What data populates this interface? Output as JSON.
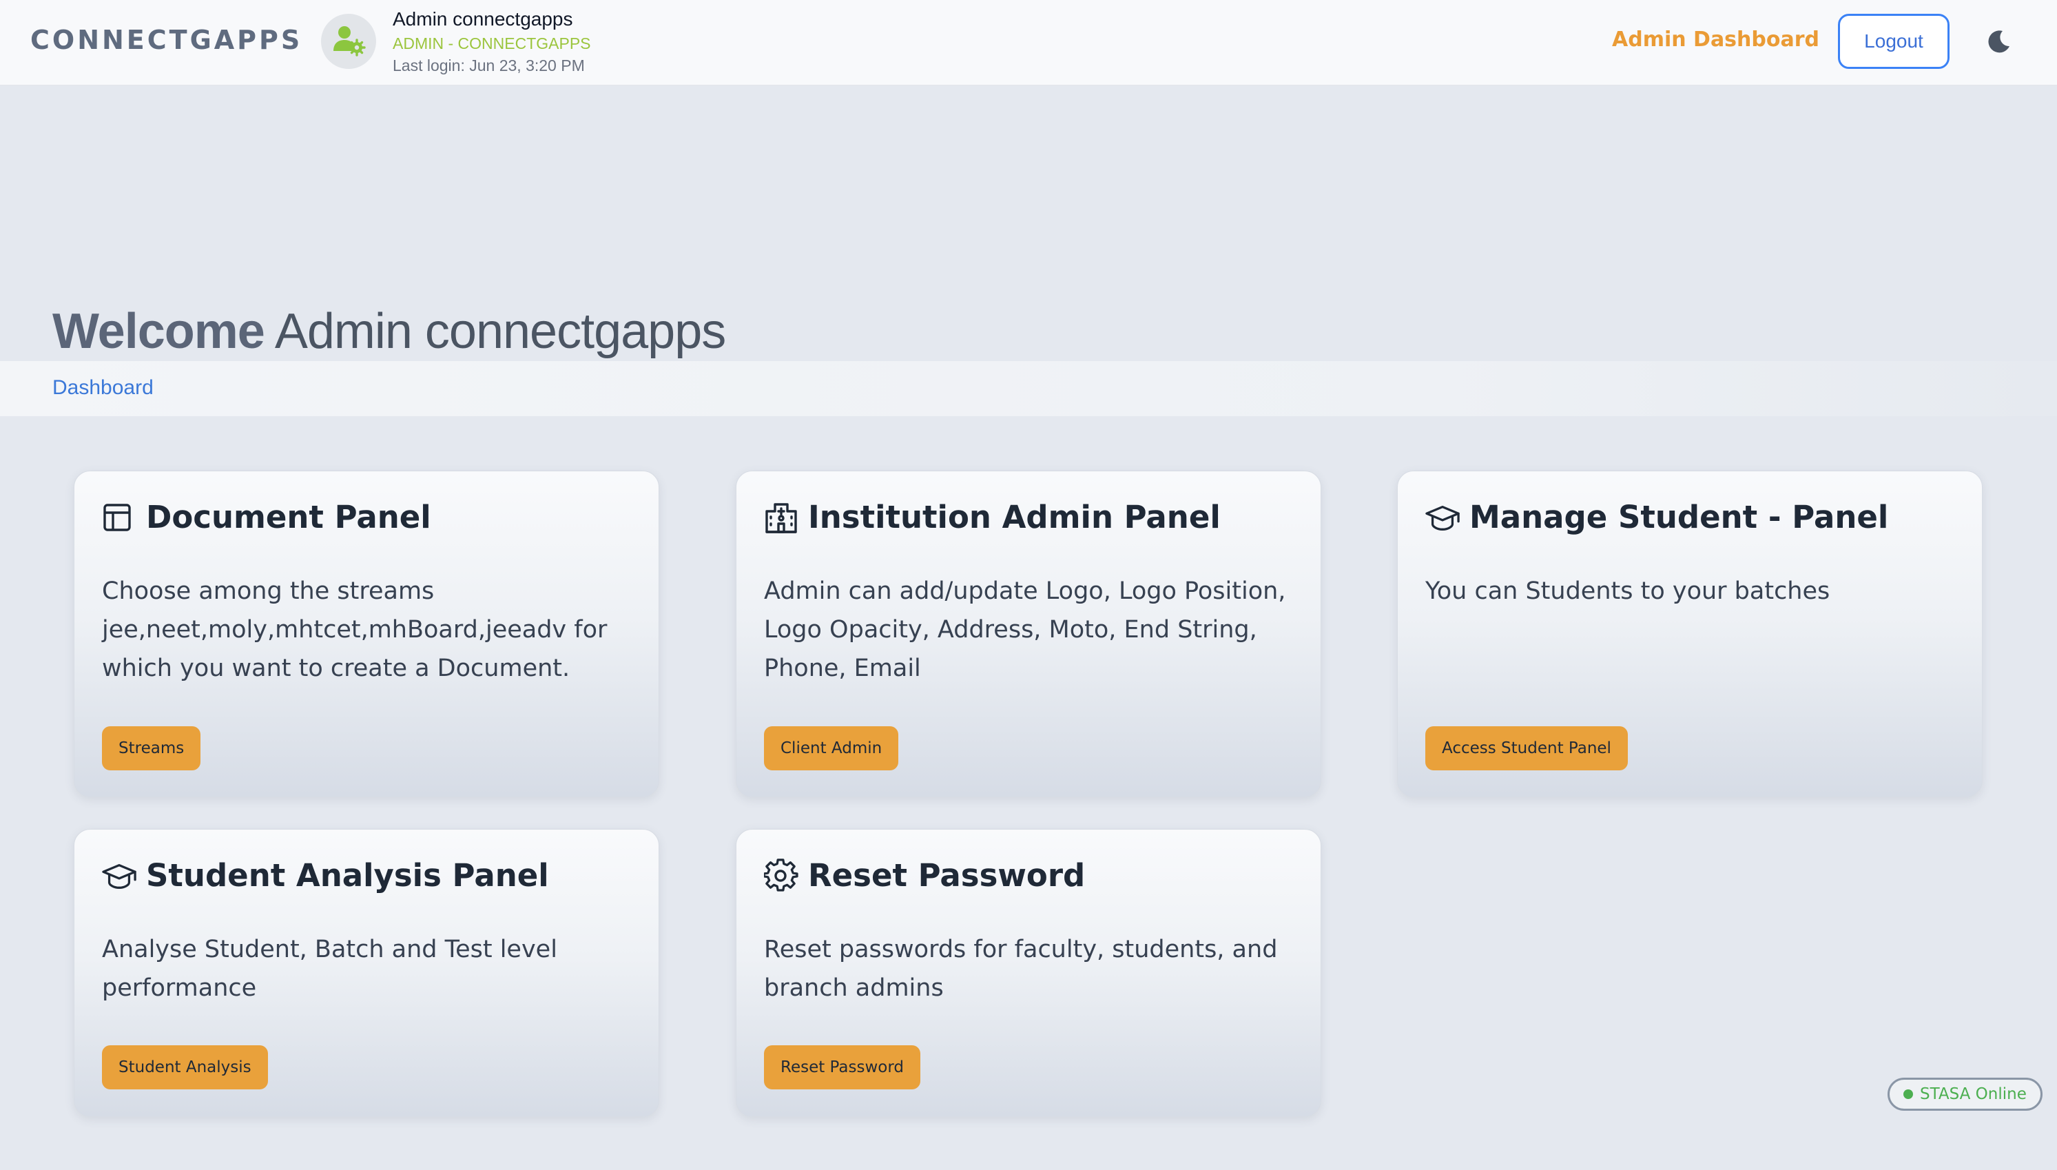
{
  "header": {
    "brand": "CONNECTGAPPS",
    "user_name": "Admin connectgapps",
    "user_role": "ADMIN - CONNECTGAPPS",
    "last_login": "Last login: Jun 23, 3:20 PM",
    "admin_dashboard_link": "Admin Dashboard",
    "logout_label": "Logout",
    "avatar_icon": "user-gear-icon",
    "theme_icon": "moon-icon"
  },
  "welcome": {
    "bold": "Welcome",
    "name": "Admin connectgapps"
  },
  "breadcrumb": {
    "item": "Dashboard"
  },
  "cards": [
    {
      "icon": "layout-icon",
      "title": "Document Panel",
      "description": "Choose among the streams jee,neet,moly,mhtcet,mhBoard,jeeadv for which you want to create a Document.",
      "button": "Streams"
    },
    {
      "icon": "building-icon",
      "title": "Institution Admin Panel",
      "description": "Admin can add/update Logo, Logo Position, Logo Opacity, Address, Moto, End String, Phone, Email",
      "button": "Client Admin"
    },
    {
      "icon": "graduation-cap-icon",
      "title": "Manage Student - Panel",
      "description": "You can Students to your batches",
      "button": "Access Student Panel"
    },
    {
      "icon": "graduation-cap-icon",
      "title": "Student Analysis Panel",
      "description": "Analyse Student, Batch and Test level performance",
      "button": "Student Analysis"
    },
    {
      "icon": "gear-icon",
      "title": "Reset Password",
      "description": "Reset passwords for faculty, students, and branch admins",
      "button": "Reset Password"
    }
  ],
  "status": {
    "label": "STASA Online",
    "color": "#4caf50"
  },
  "colors": {
    "accent_orange": "#e9a13b",
    "link_blue": "#3b78d8",
    "role_green": "#9bc53d"
  }
}
